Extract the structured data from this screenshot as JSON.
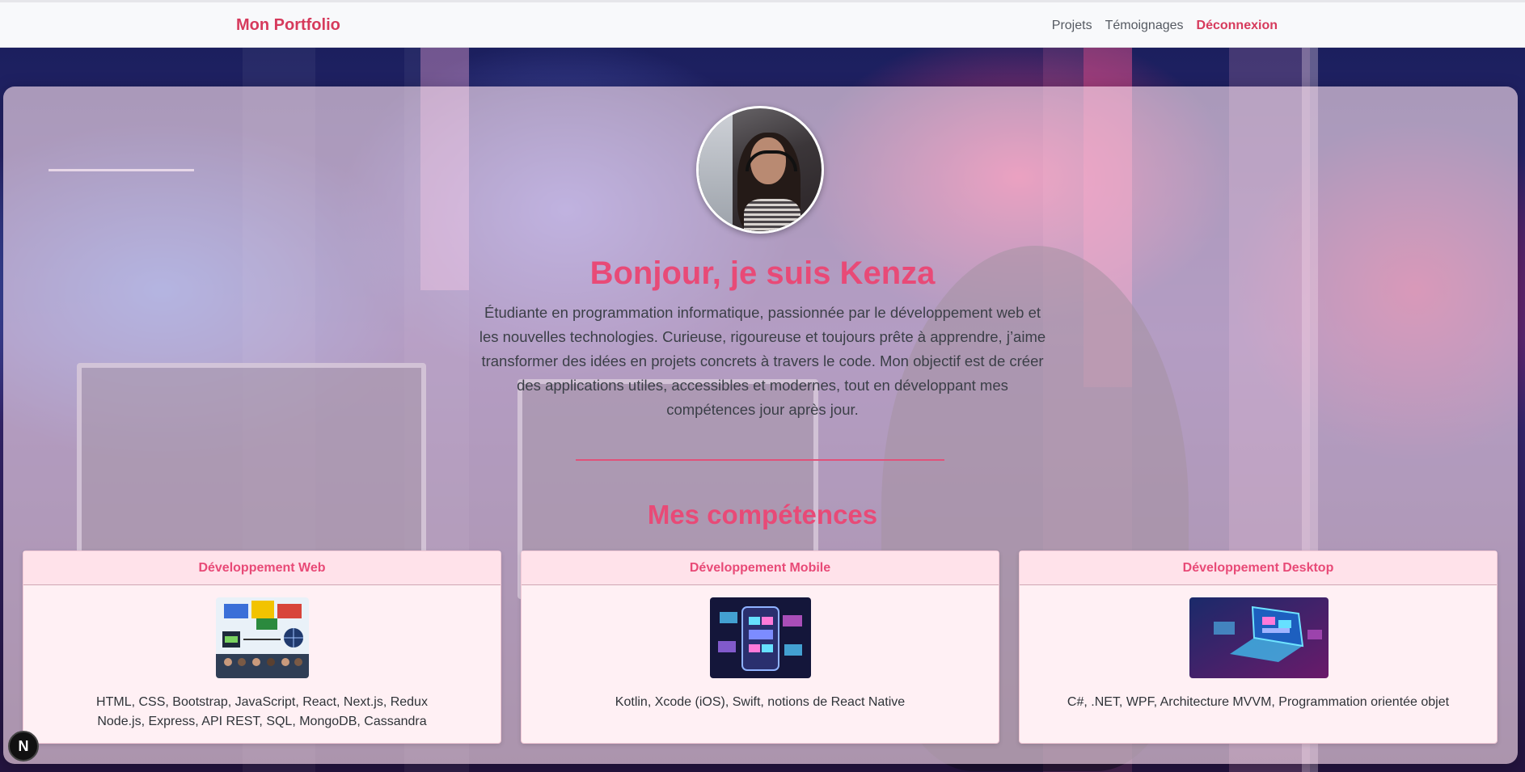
{
  "navbar": {
    "brand": "Mon Portfolio",
    "links": [
      {
        "label": "Projets",
        "active": false
      },
      {
        "label": "Témoignages",
        "active": false
      },
      {
        "label": "Déconnexion",
        "active": true
      }
    ]
  },
  "hero": {
    "title": "Bonjour, je suis Kenza",
    "description": "Étudiante en programmation informatique, passionnée par le développement web et les nouvelles technologies. Curieuse, rigoureuse et toujours prête à apprendre, j’aime transformer des idées en projets concrets à travers le code. Mon objectif est de créer des applications utiles, accessibles et modernes, tout en développant mes compétences jour après jour."
  },
  "skills": {
    "title": "Mes compétences",
    "cards": [
      {
        "title": "Développement Web",
        "line1": "HTML, CSS, Bootstrap, JavaScript, React, Next.js, Redux",
        "line2": "Node.js, Express, API REST, SQL, MongoDB, Cassandra"
      },
      {
        "title": "Développement Mobile",
        "line1": "Kotlin, Xcode (iOS), Swift, notions de React Native",
        "line2": ""
      },
      {
        "title": "Développement Desktop",
        "line1": "C#, .NET, WPF, Architecture MVVM, Programmation orientée objet",
        "line2": ""
      }
    ]
  },
  "badge": {
    "label": "N"
  },
  "colors": {
    "accent": "#e84a77",
    "brand": "#d63a5c",
    "nav_text": "#555a62"
  }
}
